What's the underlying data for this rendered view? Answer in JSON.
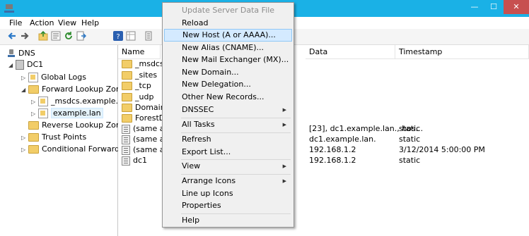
{
  "window": {
    "minimize_glyph": "—",
    "maximize_glyph": "☐",
    "close_glyph": "✕"
  },
  "menubar": [
    "File",
    "Action",
    "View",
    "Help"
  ],
  "toolbar": {
    "icons": [
      "back-icon",
      "forward-icon",
      "folder-up-icon",
      "properties-icon",
      "refresh-icon",
      "export-icon",
      "help-icon",
      "sheet-icon",
      "record-icon"
    ]
  },
  "tree": [
    {
      "label": "DNS",
      "icon": "dns-icon"
    },
    {
      "label": "DC1",
      "icon": "server-icon"
    },
    {
      "label": "Global Logs",
      "icon": "log-icon"
    },
    {
      "label": "Forward Lookup Zones",
      "icon": "folder-icon"
    },
    {
      "label": "_msdcs.example.lan",
      "icon": "zone-icon"
    },
    {
      "label": "example.lan",
      "icon": "zone-icon"
    },
    {
      "label": "Reverse Lookup Zones",
      "icon": "folder-icon"
    },
    {
      "label": "Trust Points",
      "icon": "folder-icon"
    },
    {
      "label": "Conditional Forwarders",
      "icon": "folder-icon"
    }
  ],
  "list": {
    "columns": [
      "Name",
      "Data",
      "Timestamp"
    ],
    "rows": [
      {
        "name": "_msdcs",
        "data": "",
        "timestamp": "",
        "icon": "folder-icon"
      },
      {
        "name": "_sites",
        "data": "",
        "timestamp": "",
        "icon": "folder-icon"
      },
      {
        "name": "_tcp",
        "data": "",
        "timestamp": "",
        "icon": "folder-icon"
      },
      {
        "name": "_udp",
        "data": "",
        "timestamp": "",
        "icon": "folder-icon"
      },
      {
        "name": "DomainDn",
        "data": "",
        "timestamp": "",
        "icon": "folder-icon"
      },
      {
        "name": "ForestDns",
        "data": "",
        "timestamp": "",
        "icon": "folder-icon"
      },
      {
        "name": "(same as p",
        "data": "[23], dc1.example.lan., hos...",
        "timestamp": "static",
        "icon": "record-icon"
      },
      {
        "name": "(same as p",
        "data": "dc1.example.lan.",
        "timestamp": "static",
        "icon": "record-icon"
      },
      {
        "name": "(same as p",
        "data": "192.168.1.2",
        "timestamp": "3/12/2014 5:00:00 PM",
        "icon": "record-icon"
      },
      {
        "name": "dc1",
        "data": "192.168.1.2",
        "timestamp": "static",
        "icon": "record-icon"
      }
    ]
  },
  "context_menu": [
    {
      "label": "Update Server Data File",
      "disabled": true
    },
    {
      "label": "Reload"
    },
    {
      "label": "New Host (A or AAAA)...",
      "hover": true
    },
    {
      "label": "New Alias (CNAME)..."
    },
    {
      "label": "New Mail Exchanger (MX)..."
    },
    {
      "label": "New Domain..."
    },
    {
      "label": "New Delegation..."
    },
    {
      "label": "Other New Records..."
    },
    {
      "label": "DNSSEC",
      "submenu": true
    },
    {
      "label": "All Tasks",
      "submenu": true
    },
    {
      "label": "Refresh"
    },
    {
      "label": "Export List..."
    },
    {
      "label": "View",
      "submenu": true
    },
    {
      "label": "Arrange Icons",
      "submenu": true
    },
    {
      "label": "Line up Icons"
    },
    {
      "label": "Properties"
    },
    {
      "label": "Help"
    }
  ],
  "colors": {
    "titlebar": "#1ab1e6",
    "hover": "#d4eaff",
    "close": "#c75050"
  }
}
